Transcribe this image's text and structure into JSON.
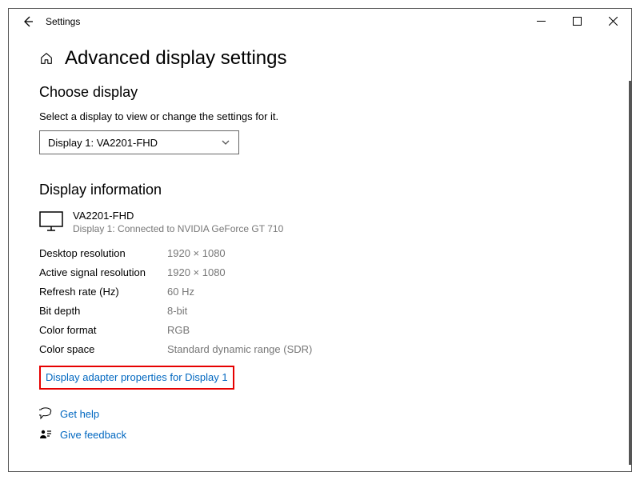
{
  "titlebar": {
    "app_name": "Settings"
  },
  "page": {
    "title": "Advanced display settings"
  },
  "choose": {
    "heading": "Choose display",
    "help": "Select a display to view or change the settings for it.",
    "selected": "Display 1: VA2201-FHD"
  },
  "info": {
    "heading": "Display information",
    "monitor_name": "VA2201-FHD",
    "monitor_sub": "Display 1: Connected to NVIDIA GeForce GT 710",
    "rows": [
      {
        "label": "Desktop resolution",
        "value": "1920 × 1080"
      },
      {
        "label": "Active signal resolution",
        "value": "1920 × 1080"
      },
      {
        "label": "Refresh rate (Hz)",
        "value": "60 Hz"
      },
      {
        "label": "Bit depth",
        "value": "8-bit"
      },
      {
        "label": "Color format",
        "value": "RGB"
      },
      {
        "label": "Color space",
        "value": "Standard dynamic range (SDR)"
      }
    ],
    "adapter_link": "Display adapter properties for Display 1"
  },
  "footer": {
    "get_help": "Get help",
    "feedback": "Give feedback"
  }
}
